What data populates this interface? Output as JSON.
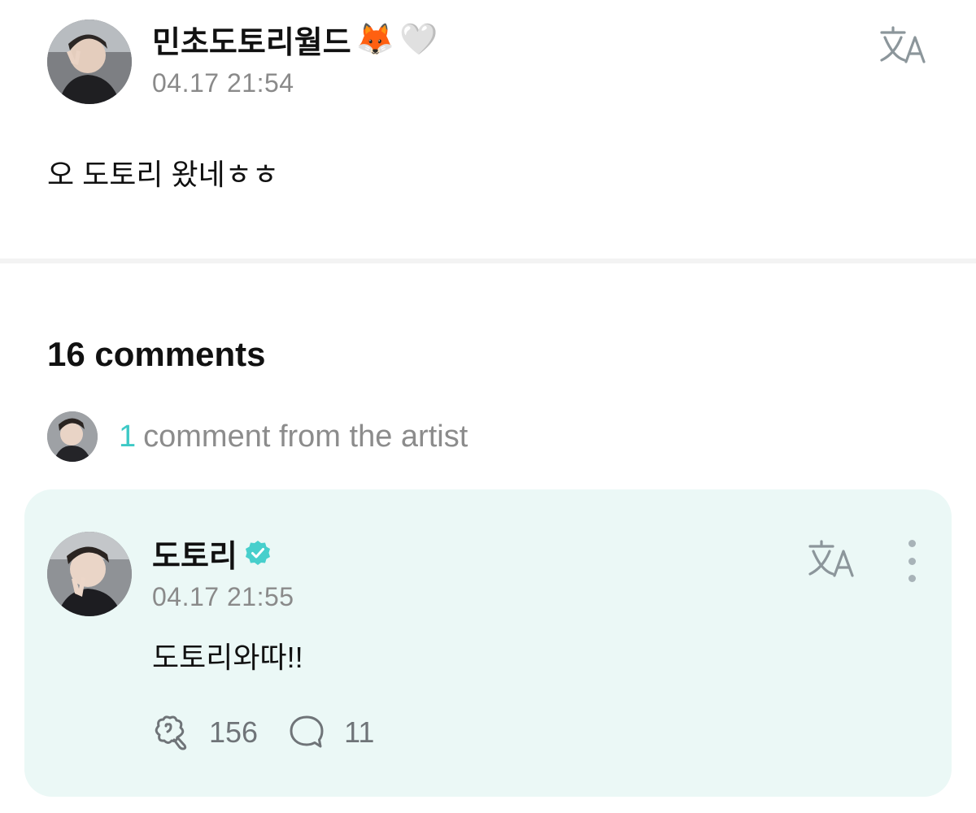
{
  "post": {
    "author": "민초도토리월드",
    "author_emoji_fox": "🦊",
    "author_emoji_heart": "🤍",
    "timestamp": "04.17 21:54",
    "body": "오 도토리 왔네ㅎㅎ",
    "translate_icon": "translate-icon",
    "avatar_icon": "user-avatar"
  },
  "comments": {
    "title": "16 comments",
    "artist_summary": {
      "count": "1",
      "label": "comment from the artist"
    },
    "artist_comment": {
      "author": "도토리",
      "verified_icon": "verified-badge-icon",
      "timestamp": "04.17 21:55",
      "body": "도토리와따!!",
      "like_count": "156",
      "reply_count": "11",
      "like_icon": "like-icon",
      "reply_icon": "reply-bubble-icon",
      "more_icon": "more-vertical-icon"
    }
  },
  "colors": {
    "accent": "#3dc9c6",
    "card_background": "#ebf8f6",
    "muted_text": "#8a8a8a",
    "primary_text": "#111111"
  }
}
